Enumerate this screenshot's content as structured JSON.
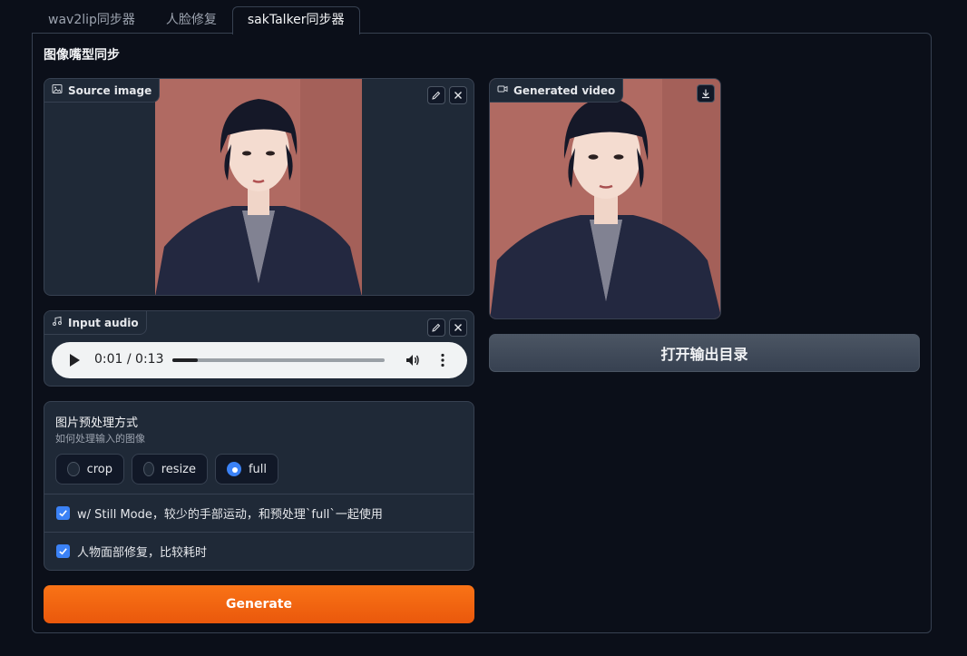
{
  "tabs": [
    {
      "label": "wav2lip同步器",
      "active": false
    },
    {
      "label": "人脸修复",
      "active": false
    },
    {
      "label": "sakTalker同步器",
      "active": true
    }
  ],
  "panel": {
    "title": "图像嘴型同步"
  },
  "source_image": {
    "label": "Source image",
    "icon": "image-icon",
    "actions": [
      "edit-icon",
      "close-icon"
    ]
  },
  "input_audio": {
    "label": "Input audio",
    "icon": "music-note-icon",
    "player": {
      "current": "0:01",
      "duration": "0:13",
      "time_text": "0:01 / 0:13",
      "progress": 0.12
    }
  },
  "preprocess": {
    "title": "图片预处理方式",
    "description": "如何处理输入的图像",
    "options": [
      "crop",
      "resize",
      "full"
    ],
    "selected": "full"
  },
  "checkboxes": [
    {
      "label": "w/ Still Mode，较少的手部运动，和预处理`full`一起使用",
      "checked": true
    },
    {
      "label": "人物面部修复，比较耗时",
      "checked": true
    }
  ],
  "generate_button": "Generate",
  "generated_video": {
    "label": "Generated video",
    "icon": "video-camera-icon",
    "actions": [
      "download-icon"
    ]
  },
  "open_output_button": "打开输出目录",
  "colors": {
    "accent": "#f97316",
    "background": "#0b0f19",
    "block": "#1f2937",
    "checkbox": "#3b82f6"
  }
}
